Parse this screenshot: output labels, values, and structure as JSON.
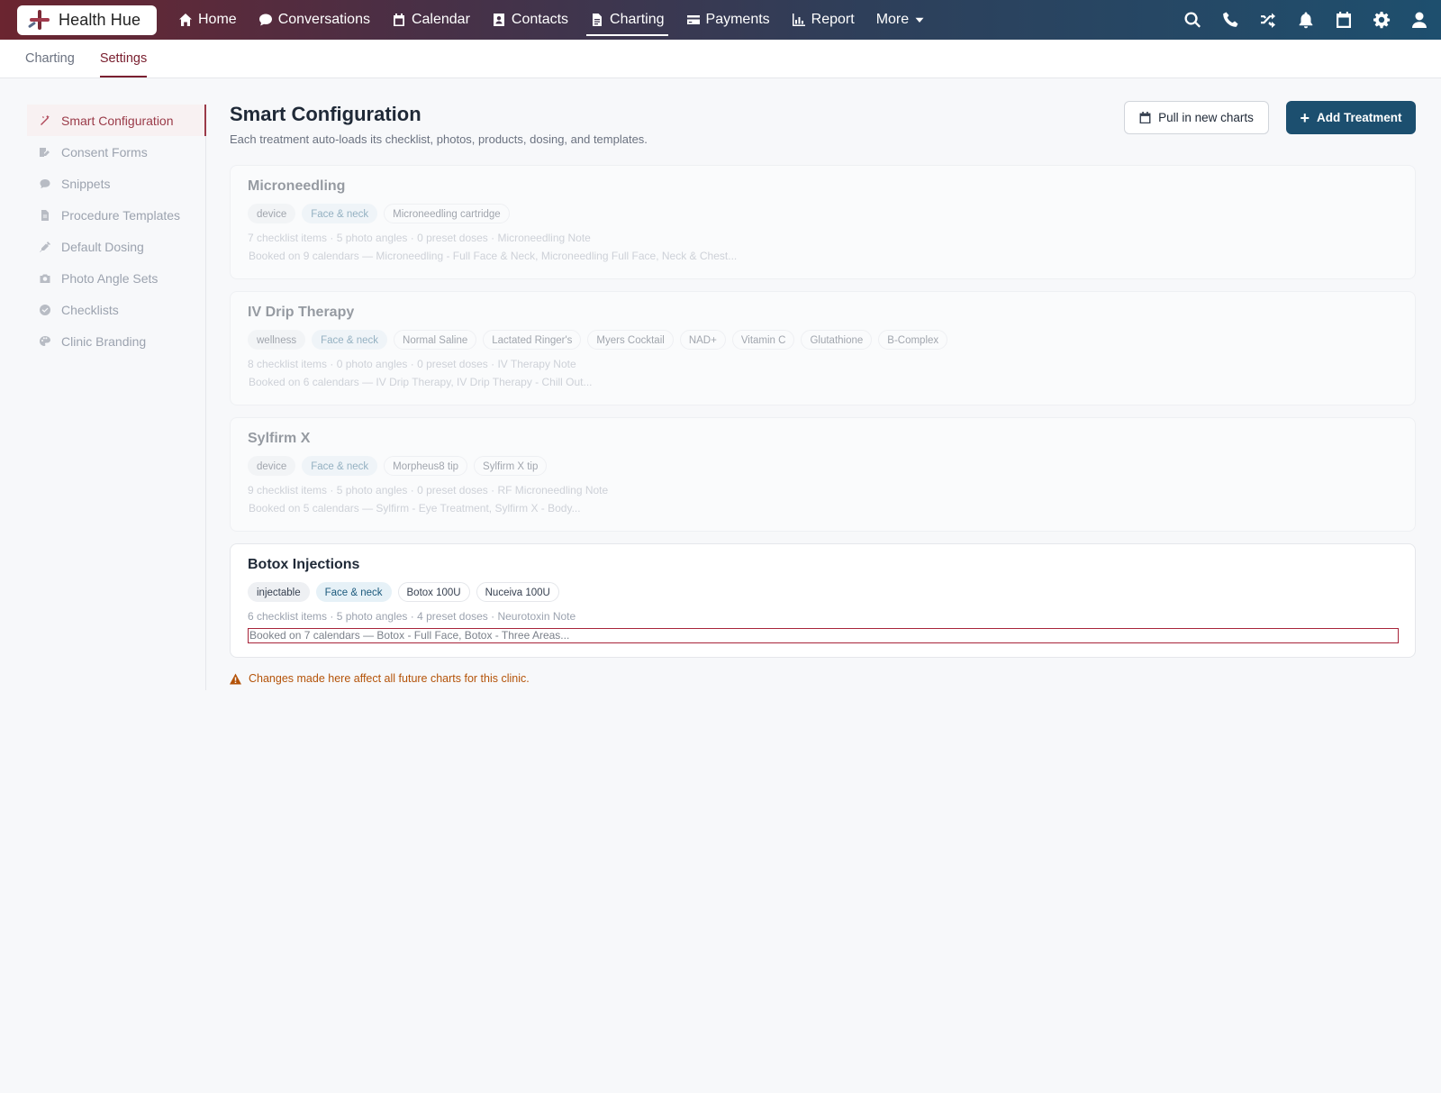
{
  "app": {
    "name": "Health Hue"
  },
  "nav": {
    "items": [
      {
        "label": "Home",
        "icon": "home-icon"
      },
      {
        "label": "Conversations",
        "icon": "chat-icon"
      },
      {
        "label": "Calendar",
        "icon": "calendar-icon"
      },
      {
        "label": "Contacts",
        "icon": "contact-card-icon"
      },
      {
        "label": "Charting",
        "icon": "document-icon",
        "active": true
      },
      {
        "label": "Payments",
        "icon": "credit-card-icon"
      },
      {
        "label": "Report",
        "icon": "bar-chart-icon"
      },
      {
        "label": "More",
        "icon": "caret-down-icon"
      }
    ],
    "right_icons": [
      "search-icon",
      "phone-icon",
      "shuffle-icon",
      "bell-icon",
      "calendar-icon",
      "gear-icon",
      "user-icon"
    ]
  },
  "subtabs": [
    {
      "label": "Charting"
    },
    {
      "label": "Settings",
      "active": true
    }
  ],
  "sidebar": {
    "items": [
      {
        "label": "Smart Configuration",
        "icon": "magic-wand-icon",
        "active": true
      },
      {
        "label": "Consent Forms",
        "icon": "signature-icon"
      },
      {
        "label": "Snippets",
        "icon": "comment-icon"
      },
      {
        "label": "Procedure Templates",
        "icon": "file-icon"
      },
      {
        "label": "Default Dosing",
        "icon": "syringe-icon"
      },
      {
        "label": "Photo Angle Sets",
        "icon": "camera-icon"
      },
      {
        "label": "Checklists",
        "icon": "check-circle-icon"
      },
      {
        "label": "Clinic Branding",
        "icon": "palette-icon"
      }
    ]
  },
  "main": {
    "title": "Smart Configuration",
    "subtitle": "Each treatment auto-loads its checklist, photos, products, dosing, and templates.",
    "pull_button": "Pull in new charts",
    "add_button": "Add Treatment",
    "notice": "Changes made here affect all future charts for this clinic."
  },
  "treatments": [
    {
      "name": "Microneedling",
      "category": "device",
      "region": "Face & neck",
      "products": [
        "Microneedling cartridge"
      ],
      "summary": "7 checklist items · 5 photo angles · 0 preset doses · Microneedling Note",
      "booked": "Booked on 9 calendars — Microneedling - Full Face & Neck, Microneedling Full Face, Neck & Chest...",
      "dimmed": true
    },
    {
      "name": "IV Drip Therapy",
      "category": "wellness",
      "region": "Face & neck",
      "products": [
        "Normal Saline",
        "Lactated Ringer's",
        "Myers Cocktail",
        "NAD+",
        "Vitamin C",
        "Glutathione",
        "B-Complex"
      ],
      "summary": "8 checklist items · 0 photo angles · 0 preset doses · IV Therapy Note",
      "booked": "Booked on 6 calendars — IV Drip Therapy, IV Drip Therapy - Chill Out...",
      "dimmed": true
    },
    {
      "name": "Sylfirm X",
      "category": "device",
      "region": "Face & neck",
      "products": [
        "Morpheus8 tip",
        "Sylfirm X tip"
      ],
      "summary": "9 checklist items · 5 photo angles · 0 preset doses · RF Microneedling Note",
      "booked": "Booked on 5 calendars — Sylfirm - Eye Treatment, Sylfirm X - Body...",
      "dimmed": true
    },
    {
      "name": "Botox Injections",
      "category": "injectable",
      "region": "Face & neck",
      "products": [
        "Botox 100U",
        "Nuceiva 100U"
      ],
      "summary": "6 checklist items · 5 photo angles · 4 preset doses · Neurotoxin Note",
      "booked": "Booked on 7 calendars — Botox - Full Face, Botox - Three Areas...",
      "dimmed": false,
      "focused": true
    }
  ],
  "colors": {
    "brand_dark": "#7a2030",
    "primary_button": "#1c4f6f",
    "region_tag_bg": "#e6f1f7",
    "region_tag_text": "#1c5a7d",
    "warning": "#b45309",
    "focus_outline": "#a8243a"
  }
}
